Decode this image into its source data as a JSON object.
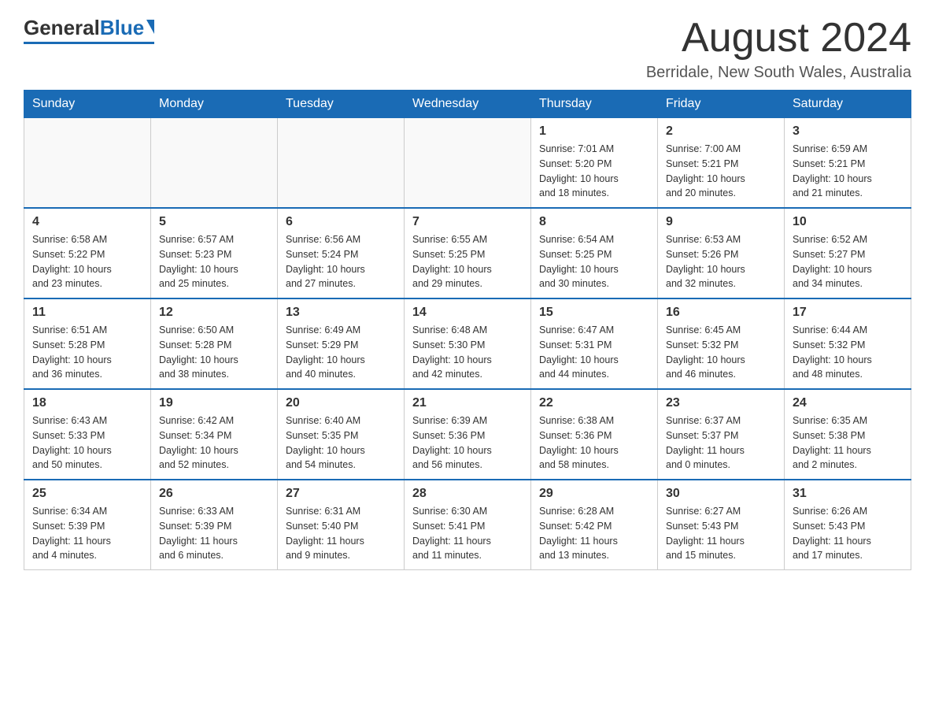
{
  "logo": {
    "general": "General",
    "blue": "Blue"
  },
  "header": {
    "title": "August 2024",
    "location": "Berridale, New South Wales, Australia"
  },
  "days_of_week": [
    "Sunday",
    "Monday",
    "Tuesday",
    "Wednesday",
    "Thursday",
    "Friday",
    "Saturday"
  ],
  "weeks": [
    [
      {
        "day": "",
        "info": ""
      },
      {
        "day": "",
        "info": ""
      },
      {
        "day": "",
        "info": ""
      },
      {
        "day": "",
        "info": ""
      },
      {
        "day": "1",
        "info": "Sunrise: 7:01 AM\nSunset: 5:20 PM\nDaylight: 10 hours\nand 18 minutes."
      },
      {
        "day": "2",
        "info": "Sunrise: 7:00 AM\nSunset: 5:21 PM\nDaylight: 10 hours\nand 20 minutes."
      },
      {
        "day": "3",
        "info": "Sunrise: 6:59 AM\nSunset: 5:21 PM\nDaylight: 10 hours\nand 21 minutes."
      }
    ],
    [
      {
        "day": "4",
        "info": "Sunrise: 6:58 AM\nSunset: 5:22 PM\nDaylight: 10 hours\nand 23 minutes."
      },
      {
        "day": "5",
        "info": "Sunrise: 6:57 AM\nSunset: 5:23 PM\nDaylight: 10 hours\nand 25 minutes."
      },
      {
        "day": "6",
        "info": "Sunrise: 6:56 AM\nSunset: 5:24 PM\nDaylight: 10 hours\nand 27 minutes."
      },
      {
        "day": "7",
        "info": "Sunrise: 6:55 AM\nSunset: 5:25 PM\nDaylight: 10 hours\nand 29 minutes."
      },
      {
        "day": "8",
        "info": "Sunrise: 6:54 AM\nSunset: 5:25 PM\nDaylight: 10 hours\nand 30 minutes."
      },
      {
        "day": "9",
        "info": "Sunrise: 6:53 AM\nSunset: 5:26 PM\nDaylight: 10 hours\nand 32 minutes."
      },
      {
        "day": "10",
        "info": "Sunrise: 6:52 AM\nSunset: 5:27 PM\nDaylight: 10 hours\nand 34 minutes."
      }
    ],
    [
      {
        "day": "11",
        "info": "Sunrise: 6:51 AM\nSunset: 5:28 PM\nDaylight: 10 hours\nand 36 minutes."
      },
      {
        "day": "12",
        "info": "Sunrise: 6:50 AM\nSunset: 5:28 PM\nDaylight: 10 hours\nand 38 minutes."
      },
      {
        "day": "13",
        "info": "Sunrise: 6:49 AM\nSunset: 5:29 PM\nDaylight: 10 hours\nand 40 minutes."
      },
      {
        "day": "14",
        "info": "Sunrise: 6:48 AM\nSunset: 5:30 PM\nDaylight: 10 hours\nand 42 minutes."
      },
      {
        "day": "15",
        "info": "Sunrise: 6:47 AM\nSunset: 5:31 PM\nDaylight: 10 hours\nand 44 minutes."
      },
      {
        "day": "16",
        "info": "Sunrise: 6:45 AM\nSunset: 5:32 PM\nDaylight: 10 hours\nand 46 minutes."
      },
      {
        "day": "17",
        "info": "Sunrise: 6:44 AM\nSunset: 5:32 PM\nDaylight: 10 hours\nand 48 minutes."
      }
    ],
    [
      {
        "day": "18",
        "info": "Sunrise: 6:43 AM\nSunset: 5:33 PM\nDaylight: 10 hours\nand 50 minutes."
      },
      {
        "day": "19",
        "info": "Sunrise: 6:42 AM\nSunset: 5:34 PM\nDaylight: 10 hours\nand 52 minutes."
      },
      {
        "day": "20",
        "info": "Sunrise: 6:40 AM\nSunset: 5:35 PM\nDaylight: 10 hours\nand 54 minutes."
      },
      {
        "day": "21",
        "info": "Sunrise: 6:39 AM\nSunset: 5:36 PM\nDaylight: 10 hours\nand 56 minutes."
      },
      {
        "day": "22",
        "info": "Sunrise: 6:38 AM\nSunset: 5:36 PM\nDaylight: 10 hours\nand 58 minutes."
      },
      {
        "day": "23",
        "info": "Sunrise: 6:37 AM\nSunset: 5:37 PM\nDaylight: 11 hours\nand 0 minutes."
      },
      {
        "day": "24",
        "info": "Sunrise: 6:35 AM\nSunset: 5:38 PM\nDaylight: 11 hours\nand 2 minutes."
      }
    ],
    [
      {
        "day": "25",
        "info": "Sunrise: 6:34 AM\nSunset: 5:39 PM\nDaylight: 11 hours\nand 4 minutes."
      },
      {
        "day": "26",
        "info": "Sunrise: 6:33 AM\nSunset: 5:39 PM\nDaylight: 11 hours\nand 6 minutes."
      },
      {
        "day": "27",
        "info": "Sunrise: 6:31 AM\nSunset: 5:40 PM\nDaylight: 11 hours\nand 9 minutes."
      },
      {
        "day": "28",
        "info": "Sunrise: 6:30 AM\nSunset: 5:41 PM\nDaylight: 11 hours\nand 11 minutes."
      },
      {
        "day": "29",
        "info": "Sunrise: 6:28 AM\nSunset: 5:42 PM\nDaylight: 11 hours\nand 13 minutes."
      },
      {
        "day": "30",
        "info": "Sunrise: 6:27 AM\nSunset: 5:43 PM\nDaylight: 11 hours\nand 15 minutes."
      },
      {
        "day": "31",
        "info": "Sunrise: 6:26 AM\nSunset: 5:43 PM\nDaylight: 11 hours\nand 17 minutes."
      }
    ]
  ]
}
